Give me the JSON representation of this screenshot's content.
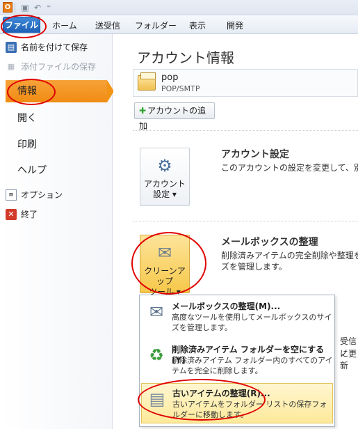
{
  "qat": {
    "app_letter": "O",
    "undo_glyph": "↶",
    "save_glyph": "▣",
    "customize_glyph": "⁼"
  },
  "ribbon": {
    "tabs": [
      "ファイル",
      "ホーム",
      "送受信",
      "フォルダー",
      "表示",
      "開発"
    ]
  },
  "nav": {
    "save_as": "名前を付けて保存",
    "save_attachments": "添付ファイルの保存",
    "info": "情報",
    "open": "開く",
    "print": "印刷",
    "help": "ヘルプ",
    "options": "オプション",
    "exit": "終了"
  },
  "main": {
    "title": "アカウント情報",
    "account_name": "pop",
    "account_type": "POP/SMTP",
    "add_account": "アカウントの追加",
    "account_settings": {
      "button_line1": "アカウント",
      "button_line2": "設定 ▾",
      "title": "アカウント設定",
      "desc": "このアカウントの設定を変更して、別の接"
    },
    "mailbox_cleanup": {
      "button_line1": "クリーンアップ",
      "button_line2": "ツール ▾",
      "title": "メールボックスの整理",
      "desc_line1": "削除済みアイテムの完全削除や整理を",
      "desc_line2": "ズを管理します。"
    },
    "behind_right_1": "受信ノ",
    "behind_right_2": "に更新"
  },
  "dropdown": {
    "items": [
      {
        "title": "メールボックスの整理(M)...",
        "desc": "高度なツールを使用してメールボックスのサイズを管理します。"
      },
      {
        "title": "削除済みアイテム フォルダーを空にする(Y)",
        "desc": "削除済みアイテム フォルダー内のすべてのアイテムを完全に削除します。"
      },
      {
        "title": "古いアイテムの整理(R)...",
        "desc": "古いアイテムをフォルダー リストの保存フォルダーに移動します。"
      }
    ]
  },
  "colors": {
    "accent_orange": "#f29414",
    "file_tab_blue": "#2a6fc4",
    "annotation_red": "#e00000"
  }
}
